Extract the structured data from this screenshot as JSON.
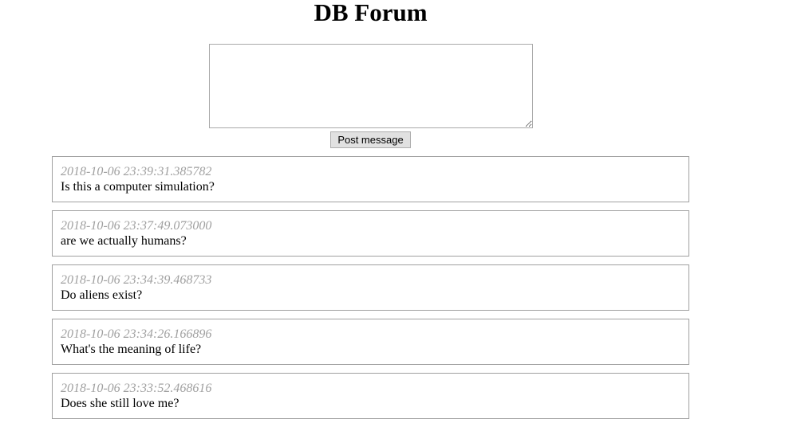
{
  "header": {
    "title": "DB Forum"
  },
  "compose": {
    "value": "",
    "post_label": "Post message"
  },
  "messages": [
    {
      "timestamp": "2018-10-06 23:39:31.385782",
      "text": "Is this a computer simulation?"
    },
    {
      "timestamp": "2018-10-06 23:37:49.073000",
      "text": "are we actually humans?"
    },
    {
      "timestamp": "2018-10-06 23:34:39.468733",
      "text": "Do aliens exist?"
    },
    {
      "timestamp": "2018-10-06 23:34:26.166896",
      "text": "What's the meaning of life?"
    },
    {
      "timestamp": "2018-10-06 23:33:52.468616",
      "text": "Does she still love me?"
    }
  ]
}
